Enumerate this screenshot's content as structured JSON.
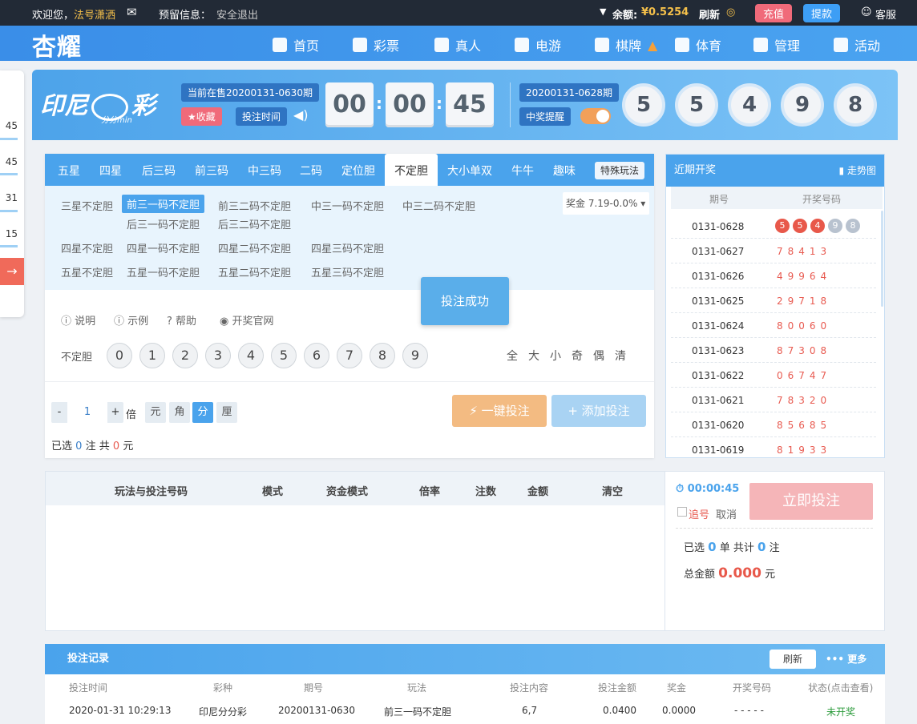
{
  "topbar": {
    "welcome": "欢迎您，",
    "username": "法号潇洒",
    "reserve_info": "预留信息：",
    "logout": "安全退出",
    "balance_label": "余额:",
    "balance": "¥0.5254",
    "refresh": "刷新",
    "recharge": "充值",
    "withdraw": "提款",
    "service": "客服"
  },
  "nav": {
    "logo": "杏耀",
    "items": [
      "首页",
      "彩票",
      "真人",
      "电游",
      "棋牌",
      "体育",
      "管理",
      "活动"
    ]
  },
  "sidebar": {
    "times": [
      "45",
      "45",
      "31",
      "15"
    ]
  },
  "lottery": {
    "brand": "印尼",
    "brand_tail": "彩",
    "brand_sub": "分分min",
    "current_issue": "当前在售20200131-0630期",
    "favorite": "收藏",
    "bet_time": "投注时间",
    "countdown": [
      "00",
      "00",
      "45"
    ],
    "last_issue": "20200131-0628期",
    "win_remind": "中奖提醒",
    "result_balls": [
      "5",
      "5",
      "4",
      "9",
      "8"
    ]
  },
  "tabs": [
    "五星",
    "四星",
    "后三码",
    "前三码",
    "中三码",
    "二码",
    "定位胆",
    "不定胆",
    "大小单双",
    "牛牛",
    "趣味"
  ],
  "special_play": "特殊玩法",
  "sub_rows": [
    {
      "group": "三星不定胆",
      "items": [
        "前三一码不定胆",
        "前三二码不定胆",
        "中三一码不定胆",
        "中三二码不定胆",
        "后三一码不定胆",
        "后三二码不定胆"
      ]
    },
    {
      "group": "四星不定胆",
      "items": [
        "四星一码不定胆",
        "四星二码不定胆",
        "四星三码不定胆"
      ]
    },
    {
      "group": "五星不定胆",
      "items": [
        "五星一码不定胆",
        "五星二码不定胆",
        "五星三码不定胆"
      ]
    }
  ],
  "prize": "奖金 7.19-0.0%",
  "toast": "投注成功",
  "tools": [
    "说明",
    "示例",
    "帮助",
    "开奖官网"
  ],
  "picker": {
    "label": "不定胆",
    "numbers": [
      "0",
      "1",
      "2",
      "3",
      "4",
      "5",
      "6",
      "7",
      "8",
      "9"
    ],
    "quick": [
      "全",
      "大",
      "小",
      "奇",
      "偶",
      "清"
    ]
  },
  "bet": {
    "minus": "-",
    "multiple": "1",
    "plus": "+",
    "multiple_label": "倍",
    "units": [
      "元",
      "角",
      "分",
      "厘"
    ],
    "one_click": "一键投注",
    "add_bet": "添加投注",
    "selected_prefix": "已选",
    "selected_count": "0",
    "selected_unit": "注",
    "total_prefix": "共",
    "total_amount": "0",
    "total_unit": "元"
  },
  "recent": {
    "title": "近期开奖",
    "trend": "走势图",
    "col_issue": "期号",
    "col_code": "开奖号码",
    "first_issue": "0131-0628",
    "first_balls": [
      "5",
      "5",
      "4",
      "9",
      "8"
    ],
    "rows": [
      {
        "issue": "0131-0627",
        "code": "78413"
      },
      {
        "issue": "0131-0626",
        "code": "49964"
      },
      {
        "issue": "0131-0625",
        "code": "29718"
      },
      {
        "issue": "0131-0624",
        "code": "80060"
      },
      {
        "issue": "0131-0623",
        "code": "87308"
      },
      {
        "issue": "0131-0622",
        "code": "06747"
      },
      {
        "issue": "0131-0621",
        "code": "78320"
      },
      {
        "issue": "0131-0620",
        "code": "85685"
      },
      {
        "issue": "0131-0619",
        "code": "81933"
      }
    ]
  },
  "orders": {
    "headers": [
      "玩法与投注号码",
      "模式",
      "资金模式",
      "倍率",
      "注数",
      "金额",
      "清空"
    ],
    "timer": "00:00:45",
    "chase": "追号",
    "cancel": "取消",
    "submit": "立即投注",
    "selected_prefix": "已选",
    "orders_count": "0",
    "orders_unit": "单 共计",
    "bets_count": "0",
    "bets_unit": "注",
    "total_label": "总金额",
    "total_amount": "0.000",
    "total_unit": "元"
  },
  "records": {
    "title": "投注记录",
    "refresh": "刷新",
    "more": "更多",
    "headers": [
      "投注时间",
      "彩种",
      "期号",
      "玩法",
      "投注内容",
      "投注金额",
      "奖金",
      "开奖号码",
      "状态(点击查看)"
    ],
    "row": [
      "2020-01-31 10:29:13",
      "印尼分分彩",
      "20200131-0630",
      "前三一码不定胆",
      "6,7",
      "0.0400",
      "0.0000",
      "- - - - -",
      "未开奖"
    ]
  },
  "colors": {
    "accent": "#4aa3ec",
    "red": "#e85a50",
    "orange": "#f2a05a"
  }
}
